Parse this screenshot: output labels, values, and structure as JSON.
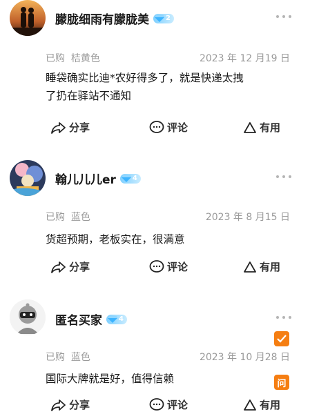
{
  "reviews": [
    {
      "username": "朦胧细雨有朦胧美",
      "level": "2",
      "purchase_label": "已购",
      "variant": "桔黄色",
      "date": "2023 年 12 月19 日",
      "content_line1": "睡袋确实比迪*农好得多了，就是快递太拽",
      "content_line2": "了扔在驿站不通知",
      "share_label": "分享",
      "comment_label": "评论",
      "helpful_label": "有用"
    },
    {
      "username": "翰儿儿儿er",
      "level": "4",
      "purchase_label": "已购",
      "variant": "蓝色",
      "date": "2023 年 8 月15 日",
      "content_line1": "货超预期，老板实在，很满意",
      "share_label": "分享",
      "comment_label": "评论",
      "helpful_label": "有用"
    },
    {
      "username": "匿名买家",
      "level": "4",
      "purchase_label": "已购",
      "variant": "蓝色",
      "date": "2023 年 10 月28 日",
      "content_line1": "国际大牌就是好，值得信赖",
      "share_label": "分享",
      "comment_label": "评论",
      "helpful_label": "有用"
    }
  ],
  "float_ask_label": "问",
  "icons": {
    "share": "share-icon",
    "comment": "comment-icon",
    "helpful": "thumbs-up-icon",
    "more": "more-icon",
    "check": "checkmark-icon"
  },
  "colors": {
    "accent_orange": "#f57e12",
    "badge_blue": "#7fd0ff",
    "meta_gray": "#9a9a9a"
  }
}
